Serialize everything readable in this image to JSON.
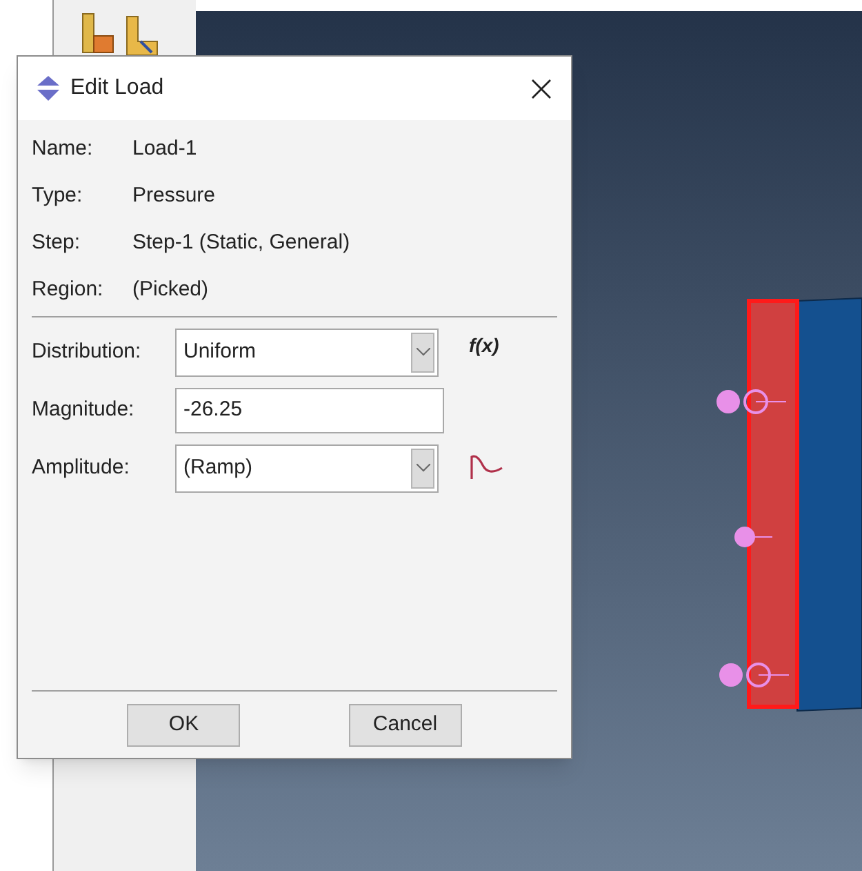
{
  "dialog": {
    "title": "Edit Load",
    "info": [
      {
        "label": "Name:",
        "value": "Load-1"
      },
      {
        "label": "Type:",
        "value": "Pressure"
      },
      {
        "label": "Step:",
        "value": "Step-1 (Static, General)"
      },
      {
        "label": "Region:",
        "value": "(Picked)"
      }
    ],
    "fields": [
      {
        "kind": "select",
        "label": "Distribution:",
        "value": "Uniform",
        "side": "f(x)"
      },
      {
        "kind": "text",
        "label": "Magnitude:",
        "value": "-26.25"
      },
      {
        "kind": "select",
        "label": "Amplitude:",
        "value": "(Ramp)",
        "wave_icon": true
      }
    ],
    "buttons": [
      "OK",
      "Cancel"
    ]
  }
}
